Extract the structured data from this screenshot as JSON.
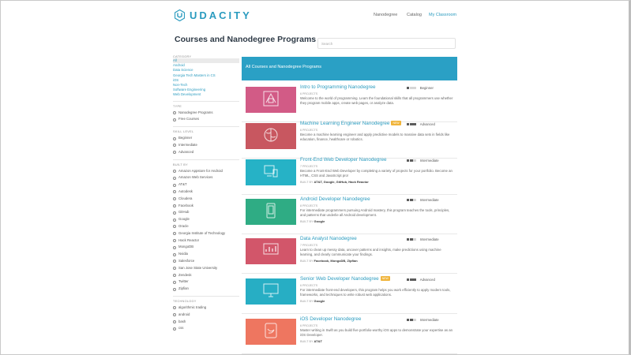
{
  "brand": {
    "name": "UDACITY",
    "color": "#2a9bbf"
  },
  "nav": [
    {
      "label": "Nanodegree"
    },
    {
      "label": "Catalog"
    },
    {
      "label": "My Classroom"
    }
  ],
  "page_title": "Courses and Nanodegree Programs",
  "search": {
    "placeholder": "Search"
  },
  "sidebar": {
    "category": {
      "heading": "Category",
      "items": [
        "All",
        "Android",
        "Data Science",
        "Georgia Tech Masters in CS",
        "iOS",
        "Non-Tech",
        "Software Engineering",
        "Web Development"
      ]
    },
    "type": {
      "heading": "Type",
      "items": [
        "Nanodegree Programs",
        "Free Courses"
      ]
    },
    "skill_level": {
      "heading": "Skill Level",
      "items": [
        "Beginner",
        "Intermediate",
        "Advanced"
      ]
    },
    "built_by": {
      "heading": "Built By",
      "items": [
        "Amazon Appstore for Android",
        "Amazon Web Services",
        "AT&T",
        "Autodesk",
        "Cloudera",
        "Facebook",
        "GitHub",
        "Google",
        "Oracle",
        "Georgia Institute of Technology",
        "Hack Reactor",
        "MongoDB",
        "Nvidia",
        "Salesforce",
        "San Jose State University",
        "Zendesk",
        "Twitter",
        "Zipfian"
      ]
    },
    "technology": {
      "heading": "Technology",
      "items": [
        "algorithmic trading",
        "android",
        "bash",
        "css"
      ]
    }
  },
  "banner": {
    "label": "All Courses and Nanodegree Programs"
  },
  "courses": [
    {
      "title": "Intro to Programming Nanodegree",
      "badge": "",
      "count": "6 PROJECTS",
      "desc": "Welcome to the world of programming. Learn the foundational skills that all programmers use whether they program mobile apps, create web pages, or analyze data.",
      "built_prefix": "",
      "built_by": "",
      "level": "Beginner",
      "level_bars": 1,
      "color": "#d25b86",
      "icon": "dashboard-icon"
    },
    {
      "title": "Machine Learning Engineer Nanodegree",
      "badge": "NEW",
      "count": "6 PROJECTS",
      "desc": "Become a machine learning engineer and apply predictive models to massive data sets in fields like education, finance, healthcare or robotics.",
      "built_prefix": "",
      "built_by": "",
      "level": "Advanced",
      "level_bars": 3,
      "color": "#c85760",
      "icon": "brain-icon"
    },
    {
      "title": "Front-End Web Developer Nanodegree",
      "badge": "",
      "count": "7 PROJECTS",
      "desc": "Become a Front-End Web Developer by completing a variety of projects for your portfolio. Become an HTML, CSS and JavaScript pro!",
      "built_prefix": "BUILT BY",
      "built_by": "AT&T, Google, GitHub, Hack Reactor",
      "level": "Intermediate",
      "level_bars": 2,
      "color": "#26b2c6",
      "icon": "devices-icon"
    },
    {
      "title": "Android Developer Nanodegree",
      "badge": "",
      "count": "8 PROJECTS",
      "desc": "For intermediate programmers pursuing Android mastery, this program teaches the tools, principles, and patterns that underlie all Android development.",
      "built_prefix": "BUILT BY",
      "built_by": "Google",
      "level": "Intermediate",
      "level_bars": 2,
      "color": "#2fac84",
      "icon": "android-phone-icon"
    },
    {
      "title": "Data Analyst Nanodegree",
      "badge": "",
      "count": "7 PROJECTS",
      "desc": "Learn to clean up messy data, uncover patterns and insights, make predictions using machine learning, and clearly communicate your findings.",
      "built_prefix": "BUILT BY",
      "built_by": "Facebook, MongoDB, Zipfian",
      "level": "Intermediate",
      "level_bars": 2,
      "color": "#d2566a",
      "icon": "chart-screen-icon"
    },
    {
      "title": "Senior Web Developer Nanodegree",
      "badge": "NEW",
      "count": "6 PROJECTS",
      "desc": "For intermediate front-end developers, this program helps you work efficiently to apply modern tools, frameworks, and techniques to write robust web applications.",
      "built_prefix": "BUILT BY",
      "built_by": "Google",
      "level": "Advanced",
      "level_bars": 3,
      "color": "#27aec4",
      "icon": "monitor-icon"
    },
    {
      "title": "iOS Developer Nanodegree",
      "badge": "",
      "count": "6 PROJECTS",
      "desc": "Master writing in Swift as you build five portfolio-worthy iOS apps to demonstrate your expertise as an iOS Developer.",
      "built_prefix": "BUILT BY",
      "built_by": "AT&T",
      "level": "Intermediate",
      "level_bars": 2,
      "color": "#ee7660",
      "icon": "swift-icon"
    }
  ]
}
